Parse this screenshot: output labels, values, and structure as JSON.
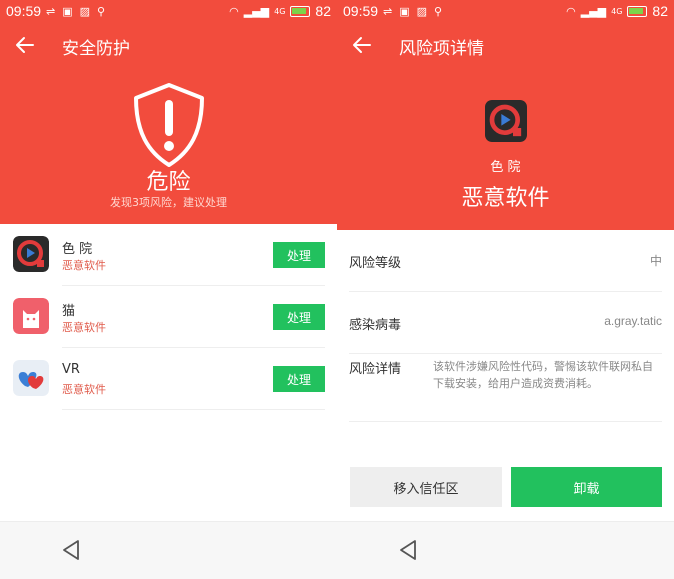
{
  "status_bar": {
    "time": "09:59",
    "network": "4G",
    "battery": "82"
  },
  "left_screen": {
    "title": "安全防护",
    "status": "危险",
    "summary": "发现3项风险，建议处理",
    "apps": [
      {
        "name": "色    院",
        "type": "恶意软件",
        "action": "处理",
        "icon": "media-player-app-icon"
      },
      {
        "name": "猫",
        "type": "恶意软件",
        "action": "处理",
        "icon": "cat-app-icon"
      },
      {
        "name": "VR",
        "type": "恶意软件",
        "action": "处理",
        "icon": "hearts-app-icon"
      }
    ]
  },
  "right_screen": {
    "title": "风险项详情",
    "app_name": "色    院",
    "app_type": "恶意软件",
    "details": {
      "risk_level_label": "风险等级",
      "risk_level_value": "中",
      "virus_label": "感染病毒",
      "virus_value": "a.gray.tatic",
      "detail_label": "风险详情",
      "detail_value": "该软件涉嫌风险性代码，警惕该软件联网私自下载安装，给用户造成资费消耗。"
    },
    "buttons": {
      "trust": "移入信任区",
      "uninstall": "卸载"
    }
  },
  "colors": {
    "header": "#f24c3d",
    "action_green": "#22c15e",
    "danger_text": "#e05b4b"
  }
}
